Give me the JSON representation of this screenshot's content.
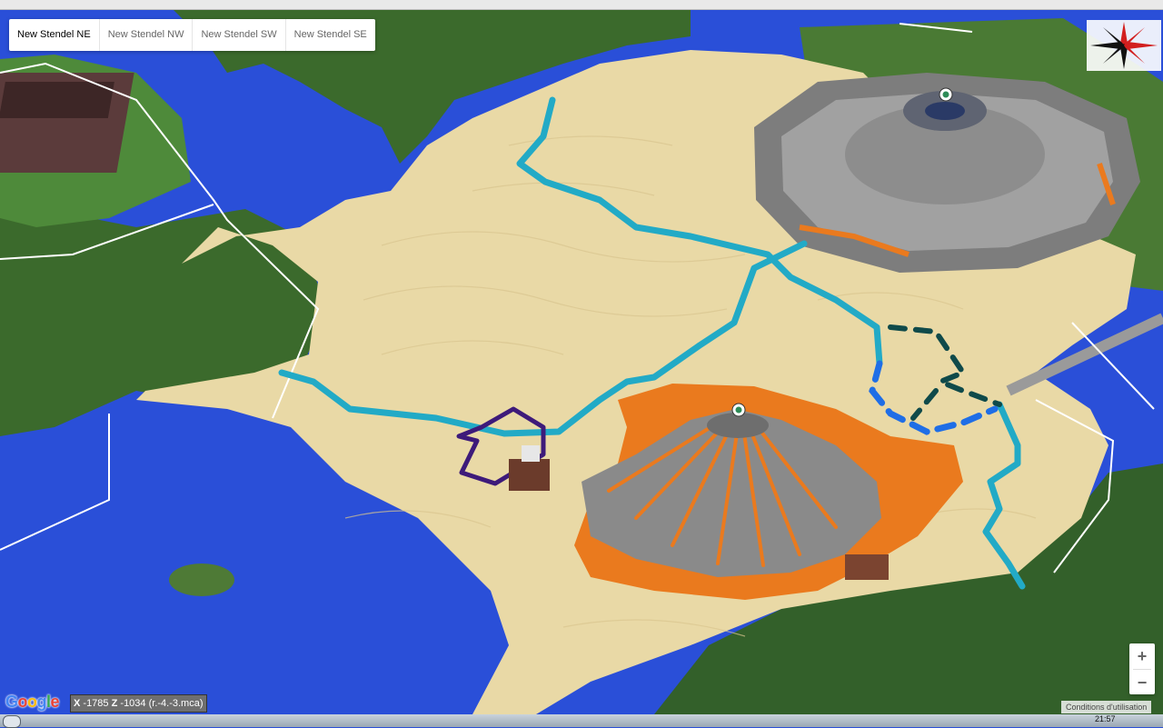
{
  "map_types": {
    "items": [
      {
        "label": "New Stendel NE",
        "active": true
      },
      {
        "label": "New Stendel NW",
        "active": false
      },
      {
        "label": "New Stendel SW",
        "active": false
      },
      {
        "label": "New Stendel SE",
        "active": false
      }
    ]
  },
  "coords": {
    "x_label": "X",
    "x_value": "-1785",
    "z_label": "Z",
    "z_value": "-1034",
    "region": "(r.-4.-3.mca)"
  },
  "zoom": {
    "in_label": "+",
    "out_label": "−"
  },
  "logo": {
    "letters": [
      "G",
      "o",
      "o",
      "g",
      "l",
      "e"
    ],
    "colors": [
      "#4285f4",
      "#ea4335",
      "#fbbc05",
      "#4285f4",
      "#34a853",
      "#ea4335"
    ]
  },
  "terms": {
    "label": "Conditions d'utilisation"
  },
  "taskbar": {
    "clock": "21:57"
  },
  "colors": {
    "water": "#2a4fd8",
    "sand": "#e9d9a6",
    "forest": "#3b6a2c",
    "lava": "#ea7a1e",
    "stone": "#8a8a8a",
    "road": "#22aac6",
    "road_blue": "#1f6ee6",
    "road_dark": "#0f4a4a",
    "road_purple": "#3d1a7a",
    "border": "#ffffff"
  },
  "icons": [
    "compass-rose-icon",
    "marker-icon"
  ]
}
